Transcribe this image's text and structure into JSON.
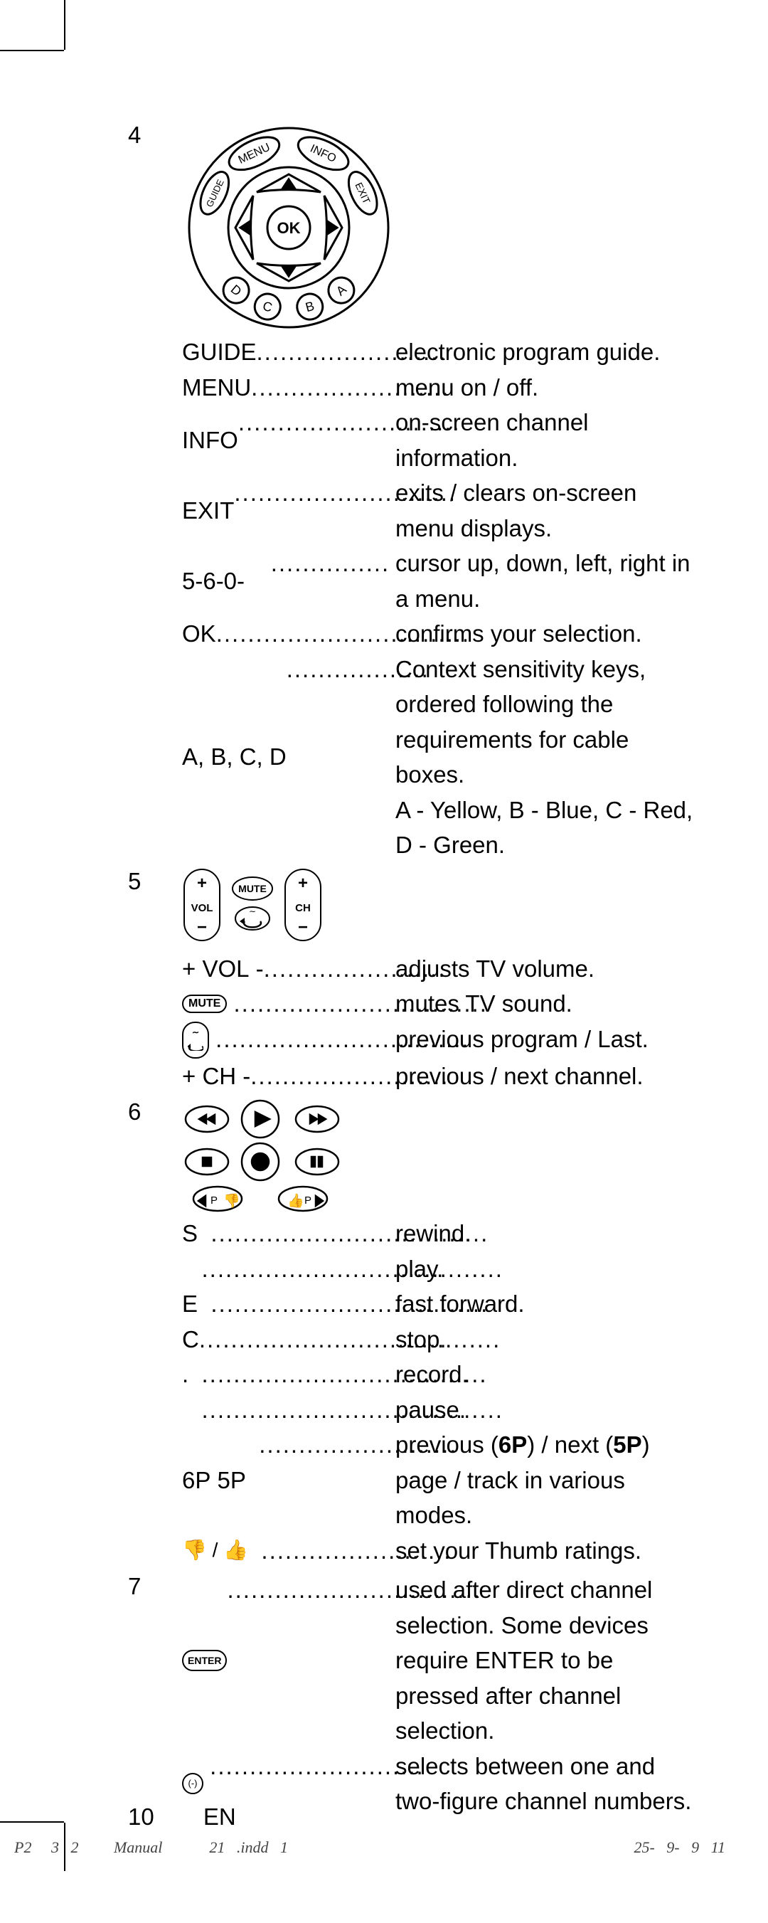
{
  "section4": {
    "num": "4",
    "dial": {
      "menu": "MENU",
      "info": "INFO",
      "guide": "GUIDE",
      "exit": "EXIT",
      "ok": "OK",
      "a": "A",
      "b": "B",
      "c": "C",
      "d": "D"
    },
    "rows": [
      {
        "label": "GUIDE",
        "dots": "........................",
        "desc": "electronic program guide."
      },
      {
        "label": "MENU",
        "dots": ".........................",
        "desc": "menu on / off."
      },
      {
        "label": "INFO",
        "dots": "............................",
        "desc": "on-screen channel information."
      },
      {
        "label": "EXIT",
        "dots": "............................",
        "desc": "exits / clears on-screen menu displays."
      },
      {
        "label": "5-6-0-    ",
        "dots": " ...............",
        "desc": "cursor up, down, left, right in a menu."
      },
      {
        "label": "OK",
        "dots": "................................",
        "desc": "confirms your selection."
      },
      {
        "label": "A, B, C, D",
        "dots": "..................",
        "desc": "Context sensitivity keys, ordered following the requirements for cable boxes.\nA - Yellow, B - Blue, C - Red, D - Green."
      }
    ]
  },
  "section5": {
    "num": "5",
    "icons": {
      "vol": "VOL",
      "mute": "MUTE",
      "ch": "CH"
    },
    "rows": [
      {
        "label": "+ VOL -",
        "dots": ".......................",
        "desc": "adjusts TV volume."
      },
      {
        "label": "__MUTE__ ",
        "dots": "................................",
        "desc": "mutes TV sound."
      },
      {
        "label": "__LAST__ ",
        "dots": "................................",
        "desc": "previous program / Last."
      },
      {
        "label": "+ CH -",
        "dots": ".........................",
        "desc": "previous / next channel."
      }
    ]
  },
  "section6": {
    "num": "6",
    "rows": [
      {
        "label": "S  ",
        "dots": "...................................",
        "desc": "rewind."
      },
      {
        "label": "   ",
        "dots": "......................................",
        "desc": "play."
      },
      {
        "label": "E  ",
        "dots": "...................................",
        "desc": "fast forward."
      },
      {
        "label": "C",
        "dots": "......................................",
        "desc": "stop."
      },
      {
        "label": ".  ",
        "dots": "....................................",
        "desc": "record."
      },
      {
        "label": "   ",
        "dots": "......................................",
        "desc": "pause."
      },
      {
        "label": "6P 5P  ",
        "dots": ".........................",
        "desc_html": "previous (<b>6P</b>) / next (<b>5P</b>) page / track in various modes."
      },
      {
        "label": "__THUMBS__  ",
        "dots": "........................",
        "desc": "set your Thumb ratings."
      }
    ]
  },
  "section7": {
    "num": "7",
    "rows": [
      {
        "label": "__ENTER__",
        "dots": "................................",
        "desc": "used after direct channel selection. Some devices require ENTER to be pressed after channel selection."
      },
      {
        "label": "__DASH__ ",
        "dots": "...........................",
        "desc": "selects between one and two-figure channel numbers."
      }
    ]
  },
  "footer": {
    "page": "10",
    "lang": "EN"
  },
  "printfoot": {
    "left": "P2     3   2         Manual            21   .indd   1",
    "right": "25-   9-   9   11"
  }
}
